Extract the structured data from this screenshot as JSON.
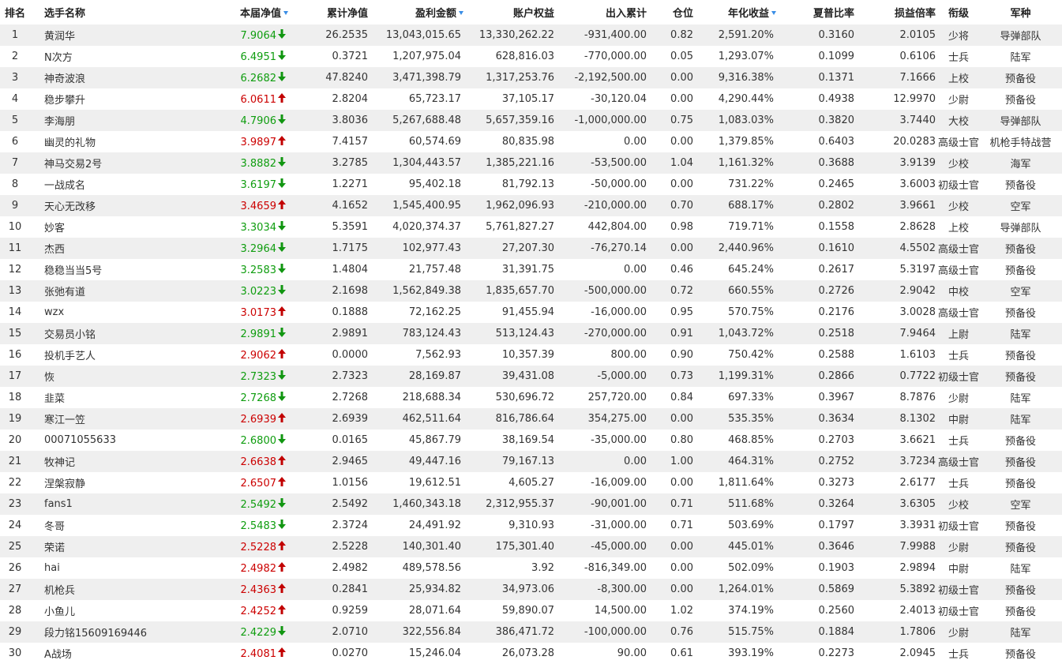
{
  "headers": {
    "rank": "排名",
    "name": "选手名称",
    "nav": "本届净值",
    "cum_nav": "累计净值",
    "profit": "盈利金额",
    "equity": "账户权益",
    "flow": "出入累计",
    "position": "仓位",
    "annual": "年化收益",
    "sharpe": "夏普比率",
    "pl_ratio": "损益倍率",
    "rank_title": "衔级",
    "branch": "军种"
  },
  "sort_icon": "sort-desc-icon",
  "colors": {
    "up": "#c20000",
    "down": "#119611",
    "stripe": "#efefef",
    "sort": "#3a8ee6"
  },
  "rows": [
    {
      "rank": "1",
      "name": "黄润华",
      "nav": "7.9064",
      "trend": "down",
      "cum_nav": "26.2535",
      "profit": "13,043,015.65",
      "equity": "13,330,262.22",
      "flow": "-931,400.00",
      "position": "0.82",
      "annual": "2,591.20%",
      "sharpe": "0.3160",
      "pl_ratio": "2.0105",
      "rank_title": "少将",
      "branch": "导弹部队"
    },
    {
      "rank": "2",
      "name": "N次方",
      "nav": "6.4951",
      "trend": "down",
      "cum_nav": "0.3721",
      "profit": "1,207,975.04",
      "equity": "628,816.03",
      "flow": "-770,000.00",
      "position": "0.05",
      "annual": "1,293.07%",
      "sharpe": "0.1099",
      "pl_ratio": "0.6106",
      "rank_title": "士兵",
      "branch": "陆军"
    },
    {
      "rank": "3",
      "name": "神奇波浪",
      "nav": "6.2682",
      "trend": "down",
      "cum_nav": "47.8240",
      "profit": "3,471,398.79",
      "equity": "1,317,253.76",
      "flow": "-2,192,500.00",
      "position": "0.00",
      "annual": "9,316.38%",
      "sharpe": "0.1371",
      "pl_ratio": "7.1666",
      "rank_title": "上校",
      "branch": "预备役"
    },
    {
      "rank": "4",
      "name": "稳步攀升",
      "nav": "6.0611",
      "trend": "up",
      "cum_nav": "2.8204",
      "profit": "65,723.17",
      "equity": "37,105.17",
      "flow": "-30,120.04",
      "position": "0.00",
      "annual": "4,290.44%",
      "sharpe": "0.4938",
      "pl_ratio": "12.9970",
      "rank_title": "少尉",
      "branch": "预备役"
    },
    {
      "rank": "5",
      "name": "李海朋",
      "nav": "4.7906",
      "trend": "down",
      "cum_nav": "3.8036",
      "profit": "5,267,688.48",
      "equity": "5,657,359.16",
      "flow": "-1,000,000.00",
      "position": "0.75",
      "annual": "1,083.03%",
      "sharpe": "0.3820",
      "pl_ratio": "3.7440",
      "rank_title": "大校",
      "branch": "导弹部队"
    },
    {
      "rank": "6",
      "name": "幽灵的礼物",
      "nav": "3.9897",
      "trend": "up",
      "cum_nav": "7.4157",
      "profit": "60,574.69",
      "equity": "80,835.98",
      "flow": "0.00",
      "position": "0.00",
      "annual": "1,379.85%",
      "sharpe": "0.6403",
      "pl_ratio": "20.0283",
      "rank_title": "高级士官",
      "branch": "机枪手特战营"
    },
    {
      "rank": "7",
      "name": "神马交易2号",
      "nav": "3.8882",
      "trend": "down",
      "cum_nav": "3.2785",
      "profit": "1,304,443.57",
      "equity": "1,385,221.16",
      "flow": "-53,500.00",
      "position": "1.04",
      "annual": "1,161.32%",
      "sharpe": "0.3688",
      "pl_ratio": "3.9139",
      "rank_title": "少校",
      "branch": "海军"
    },
    {
      "rank": "8",
      "name": "一战成名",
      "nav": "3.6197",
      "trend": "down",
      "cum_nav": "1.2271",
      "profit": "95,402.18",
      "equity": "81,792.13",
      "flow": "-50,000.00",
      "position": "0.00",
      "annual": "731.22%",
      "sharpe": "0.2465",
      "pl_ratio": "3.6003",
      "rank_title": "初级士官",
      "branch": "预备役"
    },
    {
      "rank": "9",
      "name": "天心无改移",
      "nav": "3.4659",
      "trend": "up",
      "cum_nav": "4.1652",
      "profit": "1,545,400.95",
      "equity": "1,962,096.93",
      "flow": "-210,000.00",
      "position": "0.70",
      "annual": "688.17%",
      "sharpe": "0.2802",
      "pl_ratio": "3.9661",
      "rank_title": "少校",
      "branch": "空军"
    },
    {
      "rank": "10",
      "name": "妙客",
      "nav": "3.3034",
      "trend": "down",
      "cum_nav": "5.3591",
      "profit": "4,020,374.37",
      "equity": "5,761,827.27",
      "flow": "442,804.00",
      "position": "0.98",
      "annual": "719.71%",
      "sharpe": "0.1558",
      "pl_ratio": "2.8628",
      "rank_title": "上校",
      "branch": "导弹部队"
    },
    {
      "rank": "11",
      "name": "杰西",
      "nav": "3.2964",
      "trend": "down",
      "cum_nav": "1.7175",
      "profit": "102,977.43",
      "equity": "27,207.30",
      "flow": "-76,270.14",
      "position": "0.00",
      "annual": "2,440.96%",
      "sharpe": "0.1610",
      "pl_ratio": "4.5502",
      "rank_title": "高级士官",
      "branch": "预备役"
    },
    {
      "rank": "12",
      "name": "稳稳当当5号",
      "nav": "3.2583",
      "trend": "down",
      "cum_nav": "1.4804",
      "profit": "21,757.48",
      "equity": "31,391.75",
      "flow": "0.00",
      "position": "0.46",
      "annual": "645.24%",
      "sharpe": "0.2617",
      "pl_ratio": "5.3197",
      "rank_title": "高级士官",
      "branch": "预备役"
    },
    {
      "rank": "13",
      "name": "张弛有道",
      "nav": "3.0223",
      "trend": "down",
      "cum_nav": "2.1698",
      "profit": "1,562,849.38",
      "equity": "1,835,657.70",
      "flow": "-500,000.00",
      "position": "0.72",
      "annual": "660.55%",
      "sharpe": "0.2726",
      "pl_ratio": "2.9042",
      "rank_title": "中校",
      "branch": "空军"
    },
    {
      "rank": "14",
      "name": "wzx",
      "nav": "3.0173",
      "trend": "up",
      "cum_nav": "0.1888",
      "profit": "72,162.25",
      "equity": "91,455.94",
      "flow": "-16,000.00",
      "position": "0.95",
      "annual": "570.75%",
      "sharpe": "0.2176",
      "pl_ratio": "3.0028",
      "rank_title": "高级士官",
      "branch": "预备役"
    },
    {
      "rank": "15",
      "name": "交易员小铭",
      "nav": "2.9891",
      "trend": "down",
      "cum_nav": "2.9891",
      "profit": "783,124.43",
      "equity": "513,124.43",
      "flow": "-270,000.00",
      "position": "0.91",
      "annual": "1,043.72%",
      "sharpe": "0.2518",
      "pl_ratio": "7.9464",
      "rank_title": "上尉",
      "branch": "陆军"
    },
    {
      "rank": "16",
      "name": "投机手艺人",
      "nav": "2.9062",
      "trend": "up",
      "cum_nav": "0.0000",
      "profit": "7,562.93",
      "equity": "10,357.39",
      "flow": "800.00",
      "position": "0.90",
      "annual": "750.42%",
      "sharpe": "0.2588",
      "pl_ratio": "1.6103",
      "rank_title": "士兵",
      "branch": "预备役"
    },
    {
      "rank": "17",
      "name": "恢",
      "nav": "2.7323",
      "trend": "down",
      "cum_nav": "2.7323",
      "profit": "28,169.87",
      "equity": "39,431.08",
      "flow": "-5,000.00",
      "position": "0.73",
      "annual": "1,199.31%",
      "sharpe": "0.2866",
      "pl_ratio": "0.7722",
      "rank_title": "初级士官",
      "branch": "预备役"
    },
    {
      "rank": "18",
      "name": "韭菜",
      "nav": "2.7268",
      "trend": "down",
      "cum_nav": "2.7268",
      "profit": "218,688.34",
      "equity": "530,696.72",
      "flow": "257,720.00",
      "position": "0.84",
      "annual": "697.33%",
      "sharpe": "0.3967",
      "pl_ratio": "8.7876",
      "rank_title": "少尉",
      "branch": "陆军"
    },
    {
      "rank": "19",
      "name": "寒江一笠",
      "nav": "2.6939",
      "trend": "up",
      "cum_nav": "2.6939",
      "profit": "462,511.64",
      "equity": "816,786.64",
      "flow": "354,275.00",
      "position": "0.00",
      "annual": "535.35%",
      "sharpe": "0.3634",
      "pl_ratio": "8.1302",
      "rank_title": "中尉",
      "branch": "陆军"
    },
    {
      "rank": "20",
      "name": "00071055633",
      "nav": "2.6800",
      "trend": "down",
      "cum_nav": "0.0165",
      "profit": "45,867.79",
      "equity": "38,169.54",
      "flow": "-35,000.00",
      "position": "0.80",
      "annual": "468.85%",
      "sharpe": "0.2703",
      "pl_ratio": "3.6621",
      "rank_title": "士兵",
      "branch": "预备役"
    },
    {
      "rank": "21",
      "name": "牧神记",
      "nav": "2.6638",
      "trend": "up",
      "cum_nav": "2.9465",
      "profit": "49,447.16",
      "equity": "79,167.13",
      "flow": "0.00",
      "position": "1.00",
      "annual": "464.31%",
      "sharpe": "0.2752",
      "pl_ratio": "3.7234",
      "rank_title": "高级士官",
      "branch": "预备役"
    },
    {
      "rank": "22",
      "name": "涅槃寂静",
      "nav": "2.6507",
      "trend": "up",
      "cum_nav": "1.0156",
      "profit": "19,612.51",
      "equity": "4,605.27",
      "flow": "-16,009.00",
      "position": "0.00",
      "annual": "1,811.64%",
      "sharpe": "0.3273",
      "pl_ratio": "2.6177",
      "rank_title": "士兵",
      "branch": "预备役"
    },
    {
      "rank": "23",
      "name": "fans1",
      "nav": "2.5492",
      "trend": "down",
      "cum_nav": "2.5492",
      "profit": "1,460,343.18",
      "equity": "2,312,955.37",
      "flow": "-90,001.00",
      "position": "0.71",
      "annual": "511.68%",
      "sharpe": "0.3264",
      "pl_ratio": "3.6305",
      "rank_title": "少校",
      "branch": "空军"
    },
    {
      "rank": "24",
      "name": "冬哥",
      "nav": "2.5483",
      "trend": "down",
      "cum_nav": "2.3724",
      "profit": "24,491.92",
      "equity": "9,310.93",
      "flow": "-31,000.00",
      "position": "0.71",
      "annual": "503.69%",
      "sharpe": "0.1797",
      "pl_ratio": "3.3931",
      "rank_title": "初级士官",
      "branch": "预备役"
    },
    {
      "rank": "25",
      "name": "荣诺",
      "nav": "2.5228",
      "trend": "up",
      "cum_nav": "2.5228",
      "profit": "140,301.40",
      "equity": "175,301.40",
      "flow": "-45,000.00",
      "position": "0.00",
      "annual": "445.01%",
      "sharpe": "0.3646",
      "pl_ratio": "7.9988",
      "rank_title": "少尉",
      "branch": "预备役"
    },
    {
      "rank": "26",
      "name": "hai",
      "nav": "2.4982",
      "trend": "up",
      "cum_nav": "2.4982",
      "profit": "489,578.56",
      "equity": "3.92",
      "flow": "-816,349.00",
      "position": "0.00",
      "annual": "502.09%",
      "sharpe": "0.1903",
      "pl_ratio": "2.9894",
      "rank_title": "中尉",
      "branch": "陆军"
    },
    {
      "rank": "27",
      "name": "机枪兵",
      "nav": "2.4363",
      "trend": "up",
      "cum_nav": "0.2841",
      "profit": "25,934.82",
      "equity": "34,973.06",
      "flow": "-8,300.00",
      "position": "0.00",
      "annual": "1,264.01%",
      "sharpe": "0.5869",
      "pl_ratio": "5.3892",
      "rank_title": "初级士官",
      "branch": "预备役"
    },
    {
      "rank": "28",
      "name": "小鱼儿",
      "nav": "2.4252",
      "trend": "up",
      "cum_nav": "0.9259",
      "profit": "28,071.64",
      "equity": "59,890.07",
      "flow": "14,500.00",
      "position": "1.02",
      "annual": "374.19%",
      "sharpe": "0.2560",
      "pl_ratio": "2.4013",
      "rank_title": "初级士官",
      "branch": "预备役"
    },
    {
      "rank": "29",
      "name": "段力铭15609169446",
      "nav": "2.4229",
      "trend": "down",
      "cum_nav": "2.0710",
      "profit": "322,556.84",
      "equity": "386,471.72",
      "flow": "-100,000.00",
      "position": "0.76",
      "annual": "515.75%",
      "sharpe": "0.1884",
      "pl_ratio": "1.7806",
      "rank_title": "少尉",
      "branch": "陆军"
    },
    {
      "rank": "30",
      "name": "A战场",
      "nav": "2.4081",
      "trend": "up",
      "cum_nav": "0.0270",
      "profit": "15,246.04",
      "equity": "26,073.28",
      "flow": "90.00",
      "position": "0.61",
      "annual": "393.19%",
      "sharpe": "0.2273",
      "pl_ratio": "2.0945",
      "rank_title": "士兵",
      "branch": "预备役"
    }
  ]
}
